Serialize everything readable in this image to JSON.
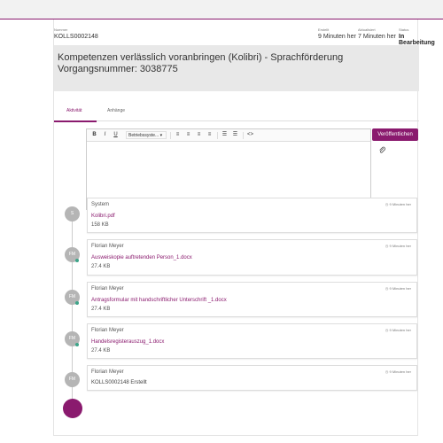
{
  "header": {
    "number_label": "Nummer",
    "number_value": "KOLLS0002148",
    "created_label": "Erstellt",
    "created_value": "9 Minuten her",
    "updated_label": "Aktualisiert",
    "updated_value": "7 Minuten her",
    "status_label": "Status",
    "status_value": "In Bearbeitung"
  },
  "title": "Kompetenzen verlässlich voranbringen (Kolibri) - Sprachförderung Vorgangsnummer: 3038775",
  "tabs": [
    {
      "label": "Aktivität"
    },
    {
      "label": "Anhänge"
    }
  ],
  "editor": {
    "font_select": "Betriebssyste...",
    "publish_label": "Veröffentlichen"
  },
  "activities": [
    {
      "initials": "S",
      "author": "System",
      "time": "9 Minuten her",
      "link": "Kolibri.pdf",
      "size": "158 KB"
    },
    {
      "initials": "FM",
      "author": "Florian Meyer",
      "time": "9 Minuten her",
      "link": "Ausweiskopie auftretenden Person_1.docx",
      "size": "27.4 KB"
    },
    {
      "initials": "FM",
      "author": "Florian Meyer",
      "time": "9 Minuten her",
      "link": "Antragsformular mit handschriftlicher Unterschrift _1.docx",
      "size": "27.4 KB"
    },
    {
      "initials": "FM",
      "author": "Florian Meyer",
      "time": "9 Minuten her",
      "link": "Handelsregisterauszug_1.docx",
      "size": "27.4 KB"
    },
    {
      "initials": "FM",
      "author": "Florian Meyer",
      "time": "9 Minuten her",
      "text": "KOLLS0002148 Erstellt"
    }
  ],
  "colors": {
    "accent": "#8a1a6e",
    "online": "#3fa58a"
  }
}
